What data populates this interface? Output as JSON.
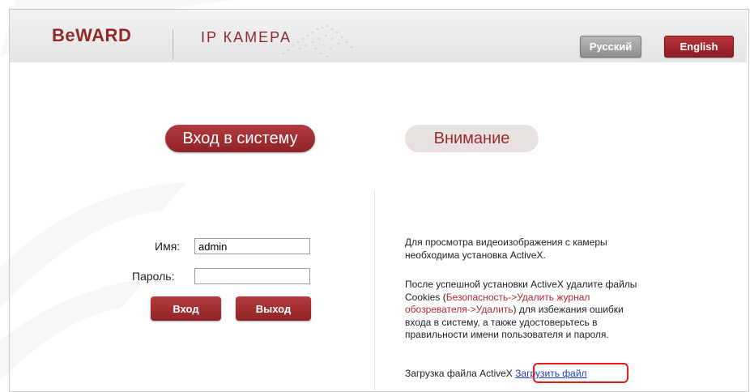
{
  "header": {
    "logo": "BeWARD",
    "subtitle": "IP КАМЕРА",
    "lang_ru": "Русский",
    "lang_en": "English"
  },
  "login": {
    "title": "Вход в систему",
    "username_label": "Имя:",
    "username_value": "admin",
    "password_label": "Пароль:",
    "password_value": "",
    "login_button": "Вход",
    "logout_button": "Выход"
  },
  "notice": {
    "title": "Внимание",
    "p1_line1": "Для просмотра видеоизображения с камеры",
    "p1_line2": "необходима установка ActiveX.",
    "p2_line1": "После успешной установки ActiveX удалите файлы",
    "p2_line2_a": "Cookies (",
    "p2_line2_b": "Безопасность->Удалить журнал",
    "p2_line3_a": "обозревателя->Удалить",
    "p2_line3_b": ") для избежания ошибки",
    "p2_line4": "входа в систему, а также удостоверьтесь в",
    "p2_line5": "правильности имени пользователя и пароля.",
    "download_label": "Загрузка файла ActiveX",
    "download_link": "Загрузить файл"
  },
  "colors": {
    "brand_red": "#8e2a2a",
    "link_blue": "#1a3ccc",
    "highlight_red": "#e51c1c"
  }
}
